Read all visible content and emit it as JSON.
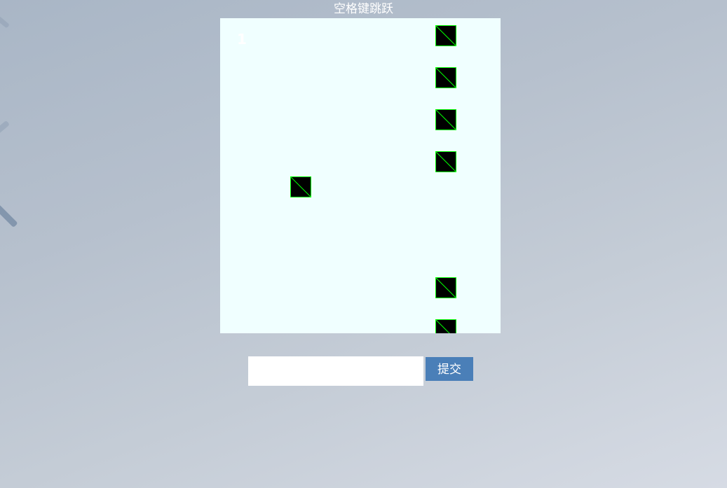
{
  "page": {
    "title": "空格键跳跃"
  },
  "game": {
    "score": "1",
    "board_color": "#f0ffff",
    "block_fill": "#000000",
    "block_border": "#00ff00",
    "block_count": 7
  },
  "form": {
    "input_value": "",
    "submit_label": "提交",
    "submit_color": "#4a7fb8"
  }
}
